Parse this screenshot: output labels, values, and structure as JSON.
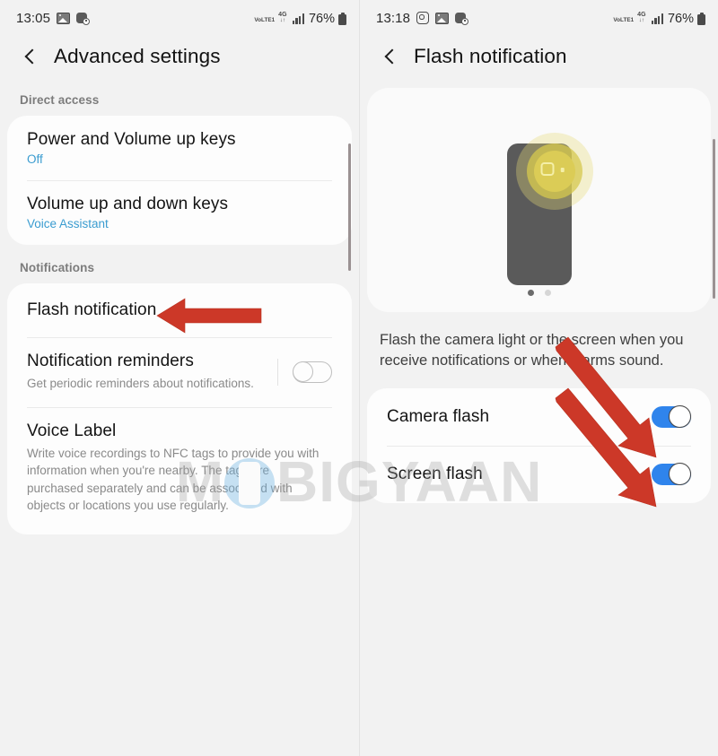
{
  "left_panel": {
    "status_bar": {
      "time": "13:05",
      "icons": [
        "image-icon",
        "clock-app-icon"
      ],
      "network_volte": "VoLTE1",
      "network_gen": "4G",
      "network_arrows": "↓↑",
      "battery_percent": "76%"
    },
    "app_bar": {
      "back": "back-icon",
      "title": "Advanced settings"
    },
    "sections": [
      {
        "label": "Direct access",
        "rows": [
          {
            "title": "Power and Volume up keys",
            "subtitle": "Off",
            "subtitle_style": "link"
          },
          {
            "title": "Volume up and down keys",
            "subtitle": "Voice Assistant",
            "subtitle_style": "link"
          }
        ]
      },
      {
        "label": "Notifications",
        "rows": [
          {
            "title": "Flash notification",
            "subtitle": "",
            "subtitle_style": "none"
          },
          {
            "title": "Notification reminders",
            "subtitle": "Get periodic reminders about notifications.",
            "subtitle_style": "muted",
            "toggle": "off"
          },
          {
            "title": "Voice Label",
            "subtitle": "Write voice recordings to NFC tags to provide you with information when you're nearby. The tags are purchased separately and can be associated with objects or locations you use regularly.",
            "subtitle_style": "muted"
          }
        ]
      }
    ]
  },
  "right_panel": {
    "status_bar": {
      "time": "13:18",
      "icons": [
        "instagram-icon",
        "image-icon",
        "clock-app-icon"
      ],
      "network_volte": "VoLTE1",
      "network_gen": "4G",
      "network_arrows": "↓↑",
      "battery_percent": "76%"
    },
    "app_bar": {
      "back": "back-icon",
      "title": "Flash notification"
    },
    "illustration": {
      "name": "phone-camera-flash-illustration",
      "page_dots": 2,
      "active_dot": 1
    },
    "description": "Flash the camera light or the screen when you receive notifications or when alarms sound.",
    "rows": [
      {
        "title": "Camera flash",
        "toggle": "on"
      },
      {
        "title": "Screen flash",
        "toggle": "on"
      }
    ]
  },
  "annotations": {
    "arrows": [
      {
        "name": "arrow-flash-notification",
        "target": "Flash notification"
      },
      {
        "name": "arrow-camera-flash-toggle",
        "target": "Camera flash"
      },
      {
        "name": "arrow-screen-flash-toggle",
        "target": "Screen flash"
      }
    ],
    "color": "#cc3828"
  },
  "watermark": {
    "part1": "M",
    "part2": "BIGYAAN"
  },
  "colors": {
    "background": "#f2f2f2",
    "card": "#fdfdfd",
    "accent_blue": "#3a9cd0",
    "toggle_on": "#2f84ec",
    "arrow_red": "#cc3828",
    "flash_yellow": "#dbcc56"
  }
}
